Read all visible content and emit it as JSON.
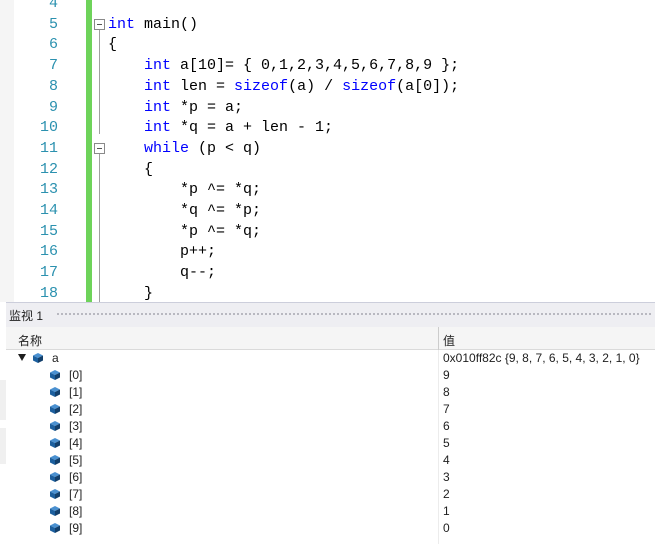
{
  "editor": {
    "lines": [
      {
        "num": "4",
        "tokens": [
          {
            "t": "",
            "k": false
          }
        ]
      },
      {
        "num": "5",
        "fold": true,
        "tokens": [
          {
            "t": "int",
            "k": true
          },
          {
            "t": " main()",
            "k": false
          }
        ]
      },
      {
        "num": "6",
        "tokens": [
          {
            "t": "{",
            "k": false
          }
        ]
      },
      {
        "num": "7",
        "tokens": [
          {
            "t": "    ",
            "k": false
          },
          {
            "t": "int",
            "k": true
          },
          {
            "t": " a[10]= { 0,1,2,3,4,5,6,7,8,9 };",
            "k": false
          }
        ]
      },
      {
        "num": "8",
        "tokens": [
          {
            "t": "    ",
            "k": false
          },
          {
            "t": "int",
            "k": true
          },
          {
            "t": " len = ",
            "k": false
          },
          {
            "t": "sizeof",
            "k": true
          },
          {
            "t": "(a) / ",
            "k": false
          },
          {
            "t": "sizeof",
            "k": true
          },
          {
            "t": "(a[0]);",
            "k": false
          }
        ]
      },
      {
        "num": "9",
        "tokens": [
          {
            "t": "    ",
            "k": false
          },
          {
            "t": "int",
            "k": true
          },
          {
            "t": " *p = a;",
            "k": false
          }
        ]
      },
      {
        "num": "10",
        "tokens": [
          {
            "t": "    ",
            "k": false
          },
          {
            "t": "int",
            "k": true
          },
          {
            "t": " *q = a + len - 1;",
            "k": false
          }
        ]
      },
      {
        "num": "11",
        "fold": true,
        "tokens": [
          {
            "t": "    ",
            "k": false
          },
          {
            "t": "while",
            "k": true
          },
          {
            "t": " (p < q)",
            "k": false
          }
        ]
      },
      {
        "num": "12",
        "tokens": [
          {
            "t": "    {",
            "k": false
          }
        ]
      },
      {
        "num": "13",
        "tokens": [
          {
            "t": "        *p ^= *q;",
            "k": false
          }
        ]
      },
      {
        "num": "14",
        "tokens": [
          {
            "t": "        *q ^= *p;",
            "k": false
          }
        ]
      },
      {
        "num": "15",
        "tokens": [
          {
            "t": "        *p ^= *q;",
            "k": false
          }
        ]
      },
      {
        "num": "16",
        "tokens": [
          {
            "t": "        p++;",
            "k": false
          }
        ]
      },
      {
        "num": "17",
        "tokens": [
          {
            "t": "        q--;",
            "k": false
          }
        ]
      },
      {
        "num": "18",
        "tokens": [
          {
            "t": "    }",
            "k": false
          }
        ]
      }
    ]
  },
  "watch": {
    "title": "监视 1",
    "col_name": "名称",
    "col_value": "值",
    "root": {
      "name": "a",
      "value": "0x010ff82c {9, 8, 7, 6, 5, 4, 3, 2, 1, 0}"
    },
    "items": [
      {
        "name": "[0]",
        "value": "9"
      },
      {
        "name": "[1]",
        "value": "8"
      },
      {
        "name": "[2]",
        "value": "7"
      },
      {
        "name": "[3]",
        "value": "6"
      },
      {
        "name": "[4]",
        "value": "5"
      },
      {
        "name": "[5]",
        "value": "4"
      },
      {
        "name": "[6]",
        "value": "3"
      },
      {
        "name": "[7]",
        "value": "2"
      },
      {
        "name": "[8]",
        "value": "1"
      },
      {
        "name": "[9]",
        "value": "0"
      }
    ]
  },
  "colors": {
    "keyword": "#0000ff",
    "line_number": "#2b91af",
    "change_bar": "#6ed35a",
    "cube": "#1c5f9e"
  },
  "icons": {
    "tree_node": "cube-icon",
    "expander": "triangle-down-icon",
    "fold": "minus-box-icon"
  }
}
